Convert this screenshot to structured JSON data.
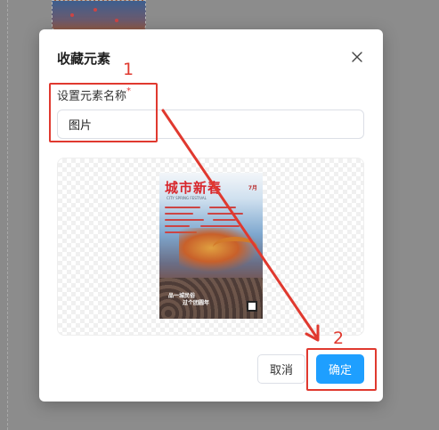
{
  "dialog": {
    "title": "收藏元素",
    "close_icon": "close-icon",
    "field_label": "设置元素名称",
    "required_mark": "*",
    "name_value": "图片",
    "cancel_label": "取消",
    "confirm_label": "确定"
  },
  "preview": {
    "poster_title": "城市新春",
    "poster_date": "7月",
    "poster_subtitle": "CITY SPRING FESTIVAL",
    "poster_slogan_1": "品一城民俗",
    "poster_slogan_2": "过个团圆年"
  },
  "annotations": {
    "step_1": "1",
    "step_2": "2",
    "color": "#e0392f"
  },
  "colors": {
    "primary": "#1e9fff",
    "overlay": "#8a8a8a"
  }
}
